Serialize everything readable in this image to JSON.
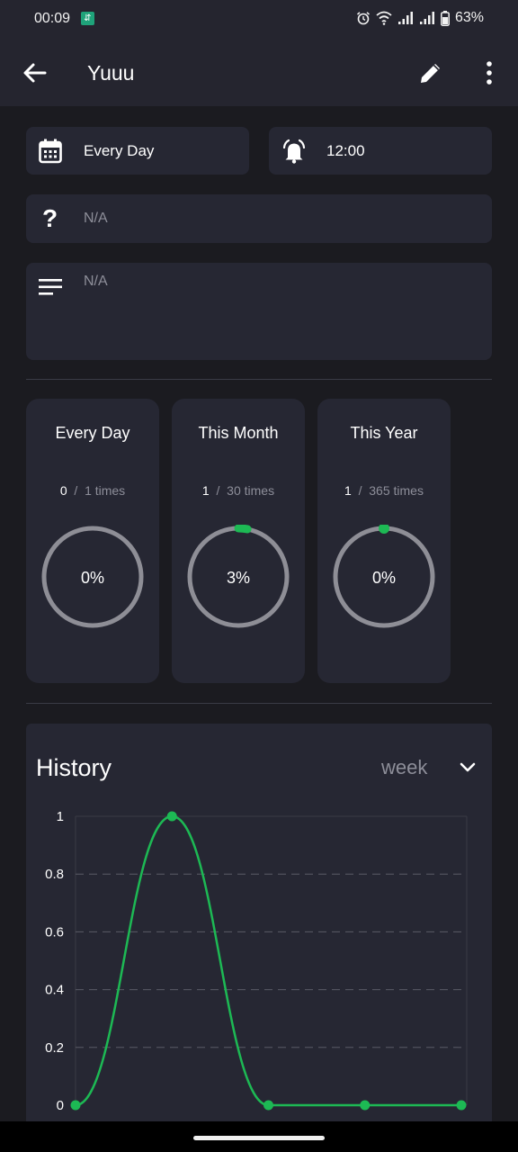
{
  "status": {
    "time": "00:09",
    "battery": "63%"
  },
  "appbar": {
    "title": "Yuuu"
  },
  "schedule": {
    "repeat": "Every Day",
    "reminder_time": "12:00"
  },
  "question": {
    "value": "N/A"
  },
  "notes": {
    "value": "N/A"
  },
  "stats": [
    {
      "title": "Every Day",
      "done": "0",
      "sep": "/",
      "target": "1 times",
      "percent": "0%",
      "progress": 0.0
    },
    {
      "title": "This Month",
      "done": "1",
      "sep": "/",
      "target": "30 times",
      "percent": "3%",
      "progress": 0.03
    },
    {
      "title": "This Year",
      "done": "1",
      "sep": "/",
      "target": "365 times",
      "percent": "0%",
      "progress": 0.003
    }
  ],
  "history": {
    "title": "History",
    "period": "week"
  },
  "colors": {
    "accent": "#1db954",
    "ring_track": "#8e8e96",
    "card": "#262733",
    "background": "#1b1b20"
  },
  "chart_data": {
    "type": "line",
    "x": [
      0,
      1,
      2,
      3,
      4
    ],
    "series": [
      {
        "values": [
          0,
          1,
          0,
          0,
          0
        ]
      }
    ],
    "ylim": [
      0,
      1
    ],
    "yticks": [
      "0",
      "0.2",
      "0.4",
      "0.6",
      "0.8",
      "1"
    ],
    "grid": true
  }
}
